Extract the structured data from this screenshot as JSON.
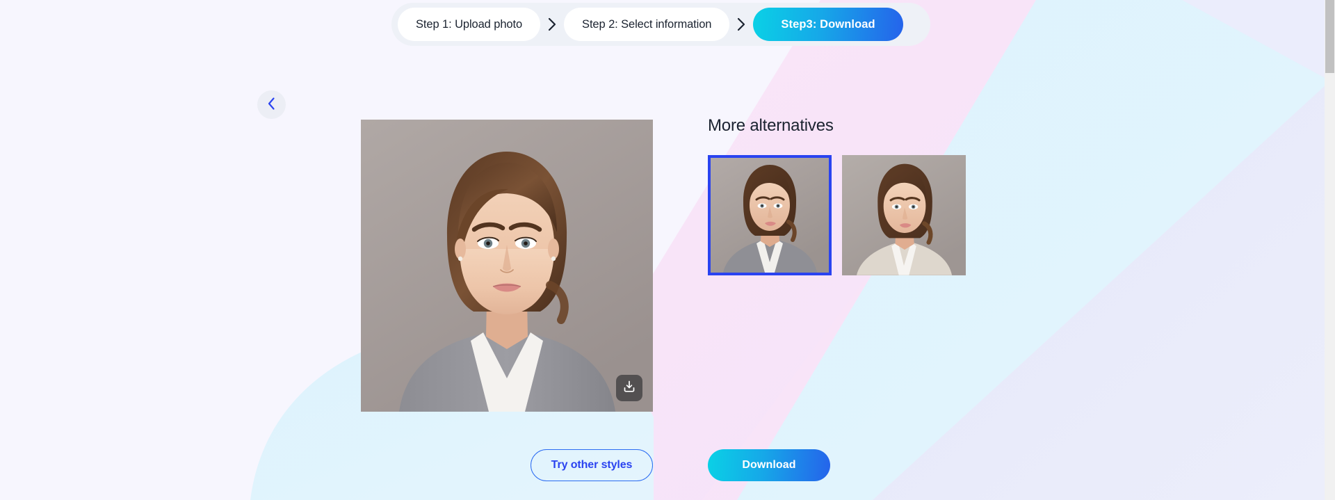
{
  "theme": {
    "page_bg": "#f7f6fe",
    "blob_pink": "#f8e3f7",
    "blob_blue": "#ddf2fc",
    "blob_periwinkle": "#e3e6f8",
    "accent_blue": "#2a43f0",
    "gradient_from": "#0ad1e6",
    "gradient_to": "#2563eb",
    "stepper_bg": "#eef1f7",
    "selected_border": "#2a43f0"
  },
  "stepper": {
    "steps": [
      {
        "label": "Step 1: Upload photo",
        "active": false
      },
      {
        "label": "Step 2: Select information",
        "active": false
      },
      {
        "label": "Step3: Download",
        "active": true
      }
    ],
    "separator": "chevron-right-icon"
  },
  "back_button": {
    "icon": "chevron-left-icon",
    "label": ""
  },
  "preview": {
    "download_overlay_icon": "download-icon",
    "alt": "portrait photo of woman in grey suit on grey background"
  },
  "alternatives": {
    "title": "More alternatives",
    "items": [
      {
        "selected": true,
        "alt": "portrait in grey suit, grey background"
      },
      {
        "selected": false,
        "alt": "portrait in beige suit, grey background"
      }
    ]
  },
  "actions": {
    "secondary_label": "Try other styles",
    "primary_label": "Download"
  },
  "scrollbar": {
    "thumb_top": 0,
    "thumb_height": 105
  }
}
